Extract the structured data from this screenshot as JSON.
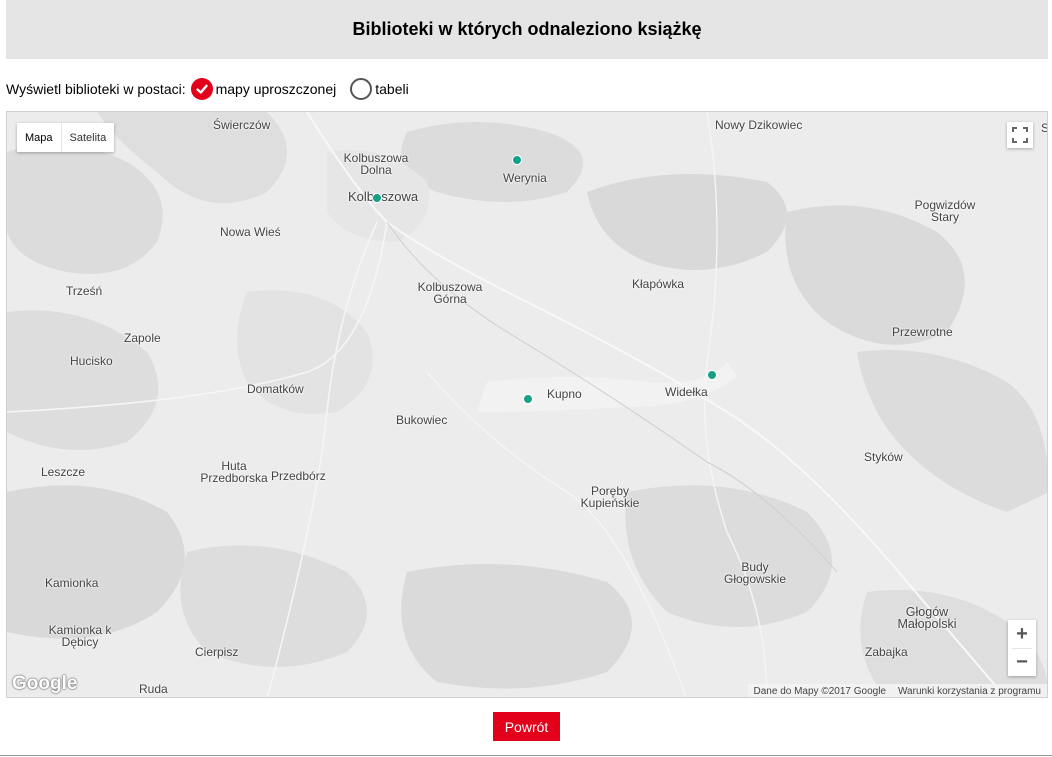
{
  "header": {
    "title": "Biblioteki w których odnaleziono książkę"
  },
  "view_toggle": {
    "label": "Wyświetl biblioteki w postaci:",
    "options": [
      {
        "label": "mapy uproszczonej",
        "selected": true
      },
      {
        "label": "tabeli",
        "selected": false
      }
    ]
  },
  "map": {
    "type_control": {
      "map_label": "Mapa",
      "satellite_label": "Satelita",
      "active": "Mapa"
    },
    "zoom_in_label": "+",
    "zoom_out_label": "−",
    "logo_text": "Google",
    "attribution": {
      "data": "Dane do Mapy ©2017 Google",
      "terms": "Warunki korzystania z programu"
    },
    "places": [
      "Świerczów",
      "Nowy Dzikowiec",
      "Kolbuszowa Dolna",
      "Werynia",
      "Kolbuszowa",
      "Pogwizdów Stary",
      "Nowa Wieś",
      "Kłapówka",
      "Kolbuszowa Górna",
      "Trześń",
      "Zapole",
      "Przewrotne",
      "Hucisko",
      "Domatków",
      "Widełka",
      "Kupno",
      "Bukowiec",
      "Styków",
      "Huta Przedborska",
      "Przedbórz",
      "Leszcze",
      "Poręby Kupieńskie",
      "Budy Głogowskie",
      "Kamionka",
      "Głogów Małopolski",
      "Kamionka k Dębicy",
      "Zabajka",
      "Cierpisz",
      "Ruda",
      "S"
    ],
    "marker_color": "#16a085"
  },
  "back_button": {
    "label": "Powrót"
  },
  "colors": {
    "accent": "#e2001a",
    "header_bg": "#e5e5e5",
    "map_bg": "#ececec"
  }
}
